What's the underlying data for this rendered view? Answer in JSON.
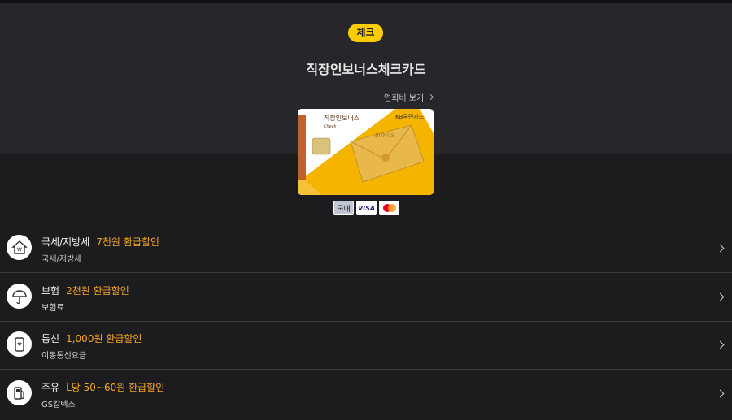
{
  "header": {
    "badge": "체크",
    "card_name": "직장인보너스체크카드",
    "fee_link": "연회비 보기"
  },
  "card_image": {
    "brand_text": "직장인보너스",
    "sub_text": "Check",
    "issuer": "KB국민카드",
    "envelope_text": "BONUS"
  },
  "brands": {
    "domestic": "국내",
    "visa": "VISA",
    "master": "mastercard-icon"
  },
  "benefits": [
    {
      "title": "국세/지방세",
      "highlight": "7천원 환급할인",
      "desc": "국세/지방세",
      "icon": "tax-house-icon"
    },
    {
      "title": "보험",
      "highlight": "2천원 환급할인",
      "desc": "보험료",
      "icon": "umbrella-icon"
    },
    {
      "title": "통신",
      "highlight": "1,000원 환급할인",
      "desc": "이동통신요금",
      "icon": "phone-icon"
    },
    {
      "title": "주유",
      "highlight": "L당 50~60원 환급할인",
      "desc": "GS칼텍스",
      "icon": "fuel-icon"
    }
  ],
  "colors": {
    "badge": "#ffcc00",
    "highlight": "#f5a623",
    "hero_bg": "#27272b",
    "page_bg": "#1c1c1e"
  }
}
